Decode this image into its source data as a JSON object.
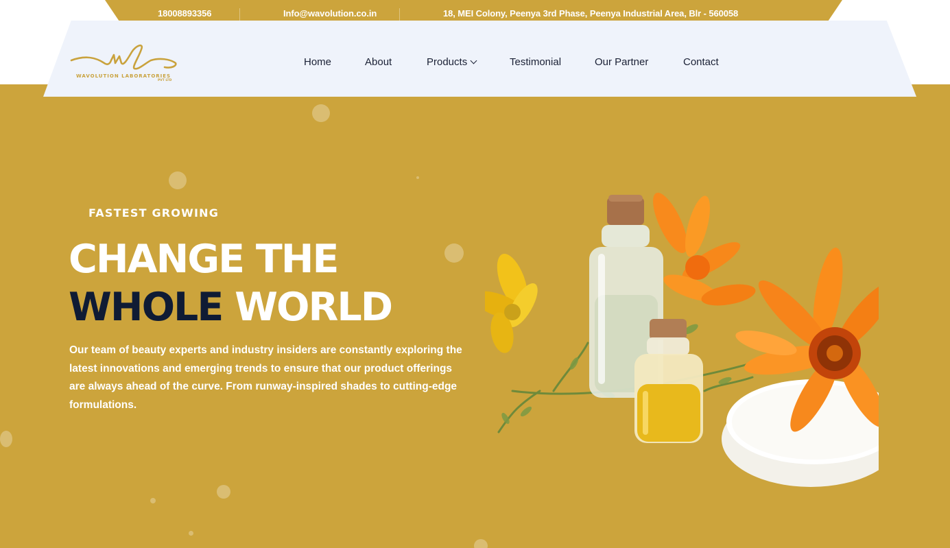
{
  "topbar": {
    "phone": "18008893356",
    "email": "Info@wavolution.co.in",
    "address": "18, MEI Colony, Peenya 3rd Phase, Peenya Industrial Area, Blr - 560058"
  },
  "logo": {
    "mark": "wl",
    "name": "WAVOLUTION LABORATORIES",
    "suffix": "PVT LTD"
  },
  "nav": {
    "items": [
      {
        "label": "Home"
      },
      {
        "label": "About"
      },
      {
        "label": "Products"
      },
      {
        "label": "Testimonial"
      },
      {
        "label": "Our Partner"
      },
      {
        "label": "Contact"
      }
    ]
  },
  "hero": {
    "kicker": "FASTEST GROWING",
    "headline_line1": "CHANGE THE",
    "headline_dark": "WHOLE",
    "headline_light": "WORLD",
    "description": "Our team of beauty experts and industry insiders are constantly exploring the latest innovations and emerging trends to ensure that our product offerings are always ahead of the curve. From runway-inspired shades to cutting-edge formulations.",
    "image": "oil-bottles-calendula-flowers-image"
  },
  "colors": {
    "brand_gold": "#cca43c",
    "nav_bg": "#eff3fb",
    "heading_dark": "#0f1b34",
    "text_dark": "#1a2035"
  }
}
